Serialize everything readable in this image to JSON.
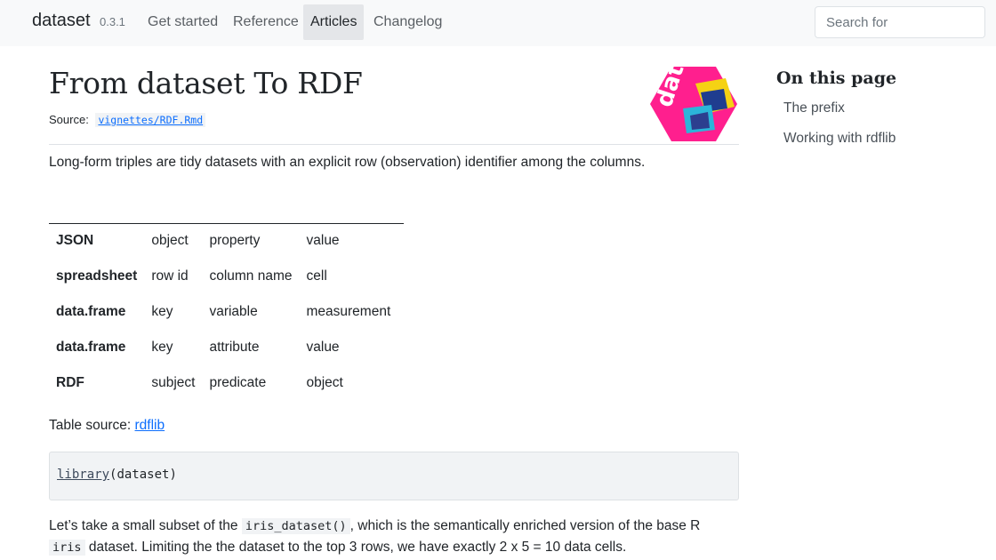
{
  "navbar": {
    "brand": "dataset",
    "version": "0.3.1",
    "links": [
      "Get started",
      "Reference",
      "Articles",
      "Changelog"
    ],
    "active": "Articles",
    "search_placeholder": "Search for"
  },
  "article": {
    "title": "From dataset To RDF",
    "source_label": "Source:",
    "source_link": "vignettes/RDF.Rmd",
    "intro": "Long-form triples are tidy datasets with an explicit row (observation) identifier among the columns.",
    "logo_text": "data"
  },
  "table": {
    "rows": [
      [
        "JSON",
        "object",
        "property",
        "value"
      ],
      [
        "spreadsheet",
        "row id",
        "column name",
        "cell"
      ],
      [
        "data.frame",
        "key",
        "variable",
        "measurement"
      ],
      [
        "data.frame",
        "key",
        "attribute",
        "value"
      ],
      [
        "RDF",
        "subject",
        "predicate",
        "object"
      ]
    ],
    "source_label": "Table source:",
    "source_link": "rdflib"
  },
  "code": {
    "fn": "library",
    "arg": "dataset"
  },
  "paragraph": {
    "p1": "Let’s take a small subset of the ",
    "code1": "iris_dataset()",
    "p2": ", which is the semantically enriched version of the base R",
    "code2": "iris",
    "p3": " dataset. Limiting the the dataset to the top 3 rows, we have exactly 2 x 5 = 10 data cells."
  },
  "toc": {
    "title": "On this page",
    "items": [
      "The prefix",
      "Working with rdflib"
    ]
  },
  "colors": {
    "link": "#0d6efd",
    "navbar_bg": "#f8f9fa",
    "logo_pink": "#ff1f8e"
  }
}
